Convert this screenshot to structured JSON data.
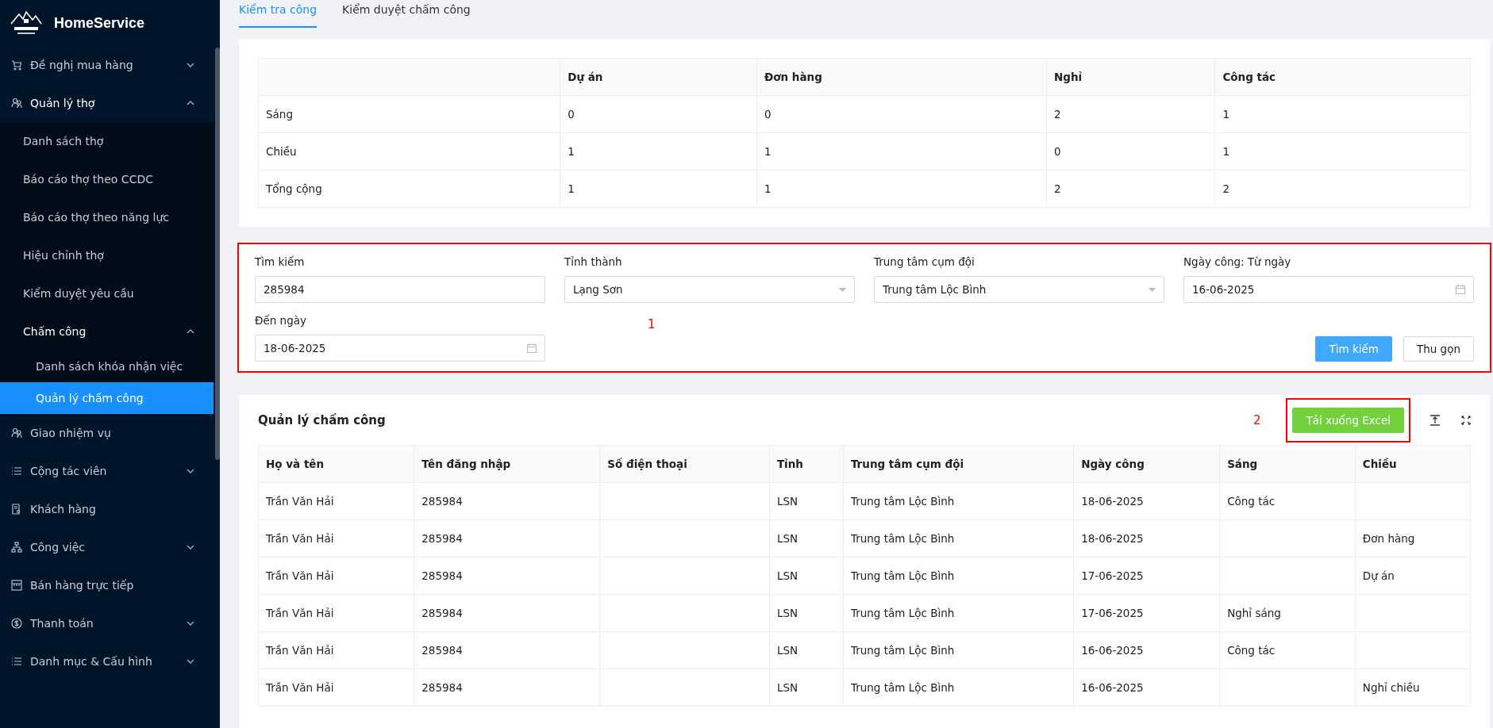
{
  "sidebar": {
    "brand": "HomeService",
    "items": [
      {
        "label": "Đề nghị mua hàng",
        "expanded": false,
        "selected": false
      },
      {
        "label": "Quản lý thợ",
        "expanded": true,
        "selected": false,
        "children": [
          {
            "label": "Danh sách thợ",
            "selected": false
          },
          {
            "label": "Báo cáo thợ theo CCDC",
            "selected": false
          },
          {
            "label": "Báo cáo thợ theo năng lực",
            "selected": false
          },
          {
            "label": "Hiệu chỉnh thợ",
            "selected": false
          },
          {
            "label": "Kiểm duyệt yêu cầu",
            "selected": false
          },
          {
            "label": "Chấm công",
            "expanded": true,
            "selected": false,
            "children": [
              {
                "label": "Danh sách khóa nhận việc",
                "selected": false
              },
              {
                "label": "Quản lý chấm công",
                "selected": true
              }
            ]
          }
        ]
      },
      {
        "label": "Giao nhiệm vụ",
        "selected": false
      },
      {
        "label": "Cộng tác viên",
        "expanded": false,
        "selected": false
      },
      {
        "label": "Khách hàng",
        "selected": false
      },
      {
        "label": "Công việc",
        "expanded": false,
        "selected": false
      },
      {
        "label": "Bán hàng trực tiếp",
        "selected": false
      },
      {
        "label": "Thanh toán",
        "expanded": false,
        "selected": false
      },
      {
        "label": "Danh mục & Cấu hình",
        "expanded": false,
        "selected": false
      }
    ]
  },
  "tabs": [
    {
      "label": "Kiểm tra công",
      "selected": true
    },
    {
      "label": "Kiểm duyệt chấm công",
      "selected": false
    }
  ],
  "summary_table": {
    "columns": [
      "",
      "Dự án",
      "Đơn hàng",
      "Nghỉ",
      "Công tác"
    ],
    "rows": [
      [
        "Sáng",
        "0",
        "0",
        "2",
        "1"
      ],
      [
        "Chiều",
        "1",
        "1",
        "0",
        "1"
      ],
      [
        "Tổng cộng",
        "1",
        "1",
        "2",
        "2"
      ]
    ]
  },
  "filter": {
    "annotation": "1",
    "fields": [
      {
        "kind": "text",
        "label": "Tìm kiếm",
        "value": "285984"
      },
      {
        "kind": "select",
        "label": "Tỉnh thành",
        "value": "Lạng Sơn"
      },
      {
        "kind": "select",
        "label": "Trung tâm cụm đội",
        "value": "Trung tâm Lộc Bình"
      },
      {
        "kind": "date",
        "label": "Ngày công: Từ ngày",
        "value": "16-06-2025"
      },
      {
        "kind": "date",
        "label": "Đến ngày",
        "value": "18-06-2025"
      }
    ],
    "buttons": [
      {
        "label": "Tìm kiếm",
        "kind": "primary"
      },
      {
        "label": "Thu gọn",
        "kind": "default"
      }
    ]
  },
  "records": {
    "title": "Quản lý chấm công",
    "export_button": "Tải xuống Excel",
    "export_annotation": "2",
    "columns": [
      "Họ và tên",
      "Tên đăng nhập",
      "Số điện thoại",
      "Tỉnh",
      "Trung tâm cụm đội",
      "Ngày công",
      "Sáng",
      "Chiều"
    ],
    "rows": [
      [
        "Trần Văn Hải",
        "285984",
        "",
        "LSN",
        "Trung tâm Lộc Bình",
        "18-06-2025",
        "Công tác",
        ""
      ],
      [
        "Trần Văn Hải",
        "285984",
        "",
        "LSN",
        "Trung tâm Lộc Bình",
        "18-06-2025",
        "",
        "Đơn hàng"
      ],
      [
        "Trần Văn Hải",
        "285984",
        "",
        "LSN",
        "Trung tâm Lộc Bình",
        "17-06-2025",
        "",
        "Dự án"
      ],
      [
        "Trần Văn Hải",
        "285984",
        "",
        "LSN",
        "Trung tâm Lộc Bình",
        "17-06-2025",
        "Nghỉ sáng",
        ""
      ],
      [
        "Trần Văn Hải",
        "285984",
        "",
        "LSN",
        "Trung tâm Lộc Bình",
        "16-06-2025",
        "Công tác",
        ""
      ],
      [
        "Trần Văn Hải",
        "285984",
        "",
        "LSN",
        "Trung tâm Lộc Bình",
        "16-06-2025",
        "",
        "Nghỉ chiều"
      ]
    ]
  }
}
